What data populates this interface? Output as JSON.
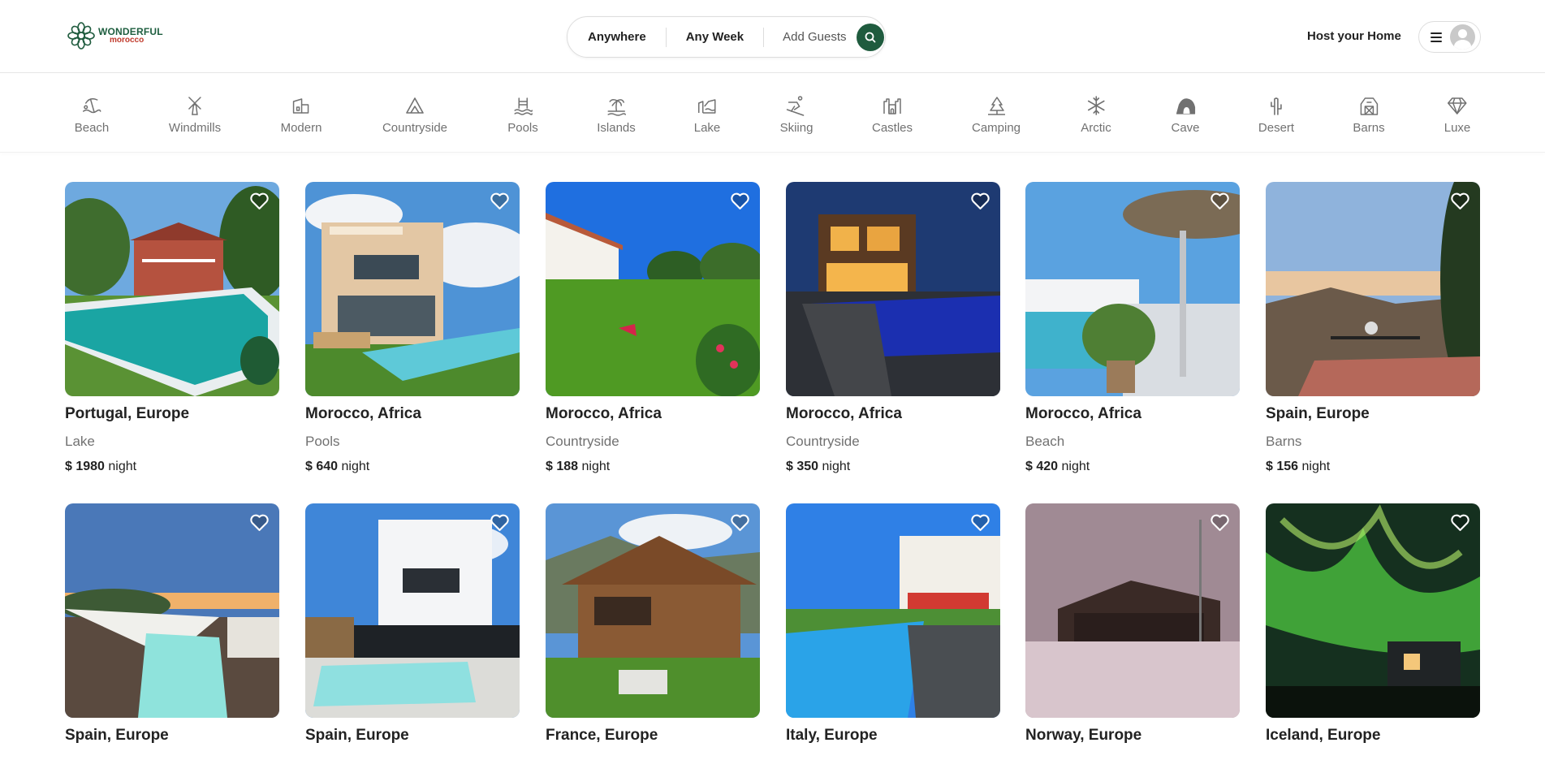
{
  "brand": {
    "line1": "WONDERFUL",
    "line2": "morocco"
  },
  "search": {
    "where": "Anywhere",
    "when": "Any Week",
    "guests": "Add Guests"
  },
  "header": {
    "host_label": "Host your Home"
  },
  "categories": [
    {
      "label": "Beach",
      "icon": "beach-icon"
    },
    {
      "label": "Windmills",
      "icon": "windmill-icon"
    },
    {
      "label": "Modern",
      "icon": "modern-icon"
    },
    {
      "label": "Countryside",
      "icon": "mountain-icon"
    },
    {
      "label": "Pools",
      "icon": "pool-icon"
    },
    {
      "label": "Islands",
      "icon": "island-icon"
    },
    {
      "label": "Lake",
      "icon": "lake-icon"
    },
    {
      "label": "Skiing",
      "icon": "skiing-icon"
    },
    {
      "label": "Castles",
      "icon": "castle-icon"
    },
    {
      "label": "Camping",
      "icon": "camping-icon"
    },
    {
      "label": "Arctic",
      "icon": "snowflake-icon"
    },
    {
      "label": "Cave",
      "icon": "cave-icon"
    },
    {
      "label": "Desert",
      "icon": "cactus-icon"
    },
    {
      "label": "Barns",
      "icon": "barn-icon"
    },
    {
      "label": "Luxe",
      "icon": "diamond-icon"
    }
  ],
  "listings": [
    {
      "location": "Portugal, Europe",
      "category": "Lake",
      "currency": "$",
      "price": "1980",
      "unit": "night"
    },
    {
      "location": "Morocco, Africa",
      "category": "Pools",
      "currency": "$",
      "price": "640",
      "unit": "night"
    },
    {
      "location": "Morocco, Africa",
      "category": "Countryside",
      "currency": "$",
      "price": "188",
      "unit": "night"
    },
    {
      "location": "Morocco, Africa",
      "category": "Countryside",
      "currency": "$",
      "price": "350",
      "unit": "night"
    },
    {
      "location": "Morocco, Africa",
      "category": "Beach",
      "currency": "$",
      "price": "420",
      "unit": "night"
    },
    {
      "location": "Spain, Europe",
      "category": "Barns",
      "currency": "$",
      "price": "156",
      "unit": "night"
    },
    {
      "location": "Spain, Europe",
      "category": "",
      "currency": "",
      "price": "",
      "unit": ""
    },
    {
      "location": "Spain, Europe",
      "category": "",
      "currency": "",
      "price": "",
      "unit": ""
    },
    {
      "location": "France, Europe",
      "category": "",
      "currency": "",
      "price": "",
      "unit": ""
    },
    {
      "location": "Italy, Europe",
      "category": "",
      "currency": "",
      "price": "",
      "unit": ""
    },
    {
      "location": "Norway, Europe",
      "category": "",
      "currency": "",
      "price": "",
      "unit": ""
    },
    {
      "location": "Iceland, Europe",
      "category": "",
      "currency": "",
      "price": "",
      "unit": ""
    }
  ],
  "colors": {
    "brand_green": "#1f5b3e",
    "brand_red": "#c0392b",
    "muted_text": "#717171"
  }
}
